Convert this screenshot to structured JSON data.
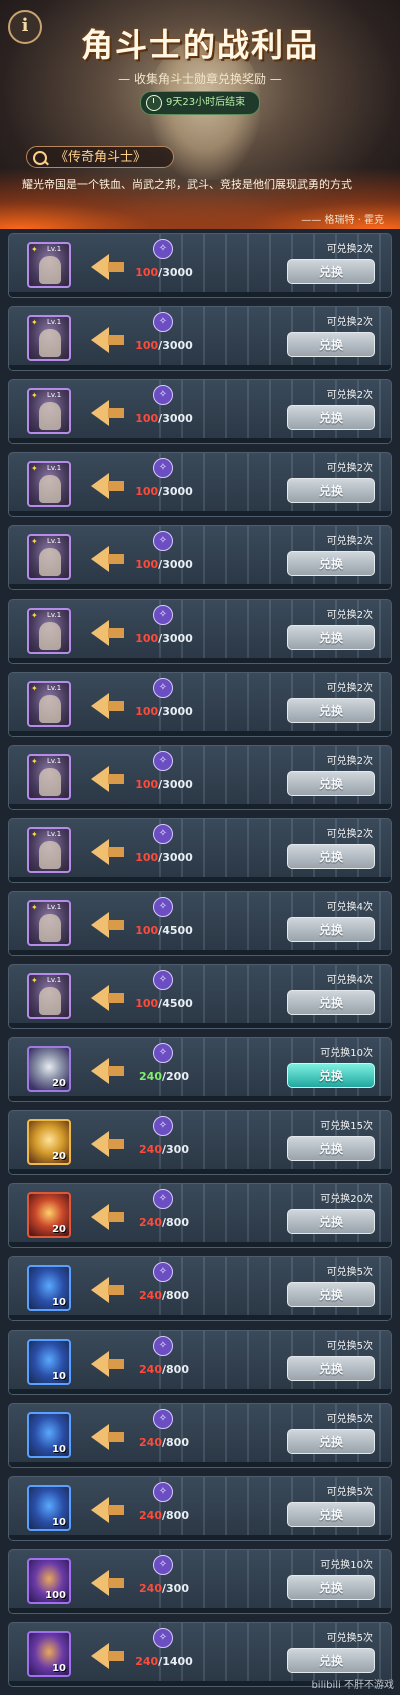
{
  "header": {
    "title": "角斗士的战利品",
    "subtitle": "— 收集角斗士勋章兑换奖励 —",
    "timer": "9天23小时后结束",
    "info_label": "i",
    "lore_tag": "《传奇角斗士》",
    "lore_text": "耀光帝国是一个铁血、尚武之邦，武斗、竞技是他们展现武勇的方式",
    "lore_author": "—— 格瑞特 · 霍克"
  },
  "rows": [
    {
      "item_type": "hero",
      "lv": "Lv.1",
      "qty": "",
      "have": "100",
      "need": "3000",
      "remain": "可兑换2次",
      "button": "兑换",
      "active": false
    },
    {
      "item_type": "hero",
      "lv": "Lv.1",
      "qty": "",
      "have": "100",
      "need": "3000",
      "remain": "可兑换2次",
      "button": "兑换",
      "active": false
    },
    {
      "item_type": "hero",
      "lv": "Lv.1",
      "qty": "",
      "have": "100",
      "need": "3000",
      "remain": "可兑换2次",
      "button": "兑换",
      "active": false
    },
    {
      "item_type": "hero",
      "lv": "Lv.1",
      "qty": "",
      "have": "100",
      "need": "3000",
      "remain": "可兑换2次",
      "button": "兑换",
      "active": false
    },
    {
      "item_type": "hero",
      "lv": "Lv.1",
      "qty": "",
      "have": "100",
      "need": "3000",
      "remain": "可兑换2次",
      "button": "兑换",
      "active": false
    },
    {
      "item_type": "hero",
      "lv": "Lv.1",
      "qty": "",
      "have": "100",
      "need": "3000",
      "remain": "可兑换2次",
      "button": "兑换",
      "active": false
    },
    {
      "item_type": "hero",
      "lv": "Lv.1",
      "qty": "",
      "have": "100",
      "need": "3000",
      "remain": "可兑换2次",
      "button": "兑换",
      "active": false
    },
    {
      "item_type": "hero",
      "lv": "Lv.1",
      "qty": "",
      "have": "100",
      "need": "3000",
      "remain": "可兑换2次",
      "button": "兑换",
      "active": false
    },
    {
      "item_type": "hero",
      "lv": "Lv.1",
      "qty": "",
      "have": "100",
      "need": "3000",
      "remain": "可兑换2次",
      "button": "兑换",
      "active": false
    },
    {
      "item_type": "hero",
      "lv": "Lv.1",
      "qty": "",
      "have": "100",
      "need": "4500",
      "remain": "可兑换4次",
      "button": "兑换",
      "active": false
    },
    {
      "item_type": "hero",
      "lv": "Lv.1",
      "qty": "",
      "have": "100",
      "need": "4500",
      "remain": "可兑换4次",
      "button": "兑换",
      "active": false
    },
    {
      "item_type": "coin-silver",
      "lv": "",
      "qty": "20",
      "have": "240",
      "need": "200",
      "remain": "可兑换10次",
      "button": "兑换",
      "active": true
    },
    {
      "item_type": "coin-gold",
      "lv": "",
      "qty": "20",
      "have": "240",
      "need": "300",
      "remain": "可兑换15次",
      "button": "兑换",
      "active": false
    },
    {
      "item_type": "coin-red",
      "lv": "",
      "qty": "20",
      "have": "240",
      "need": "800",
      "remain": "可兑换20次",
      "button": "兑换",
      "active": false
    },
    {
      "item_type": "card-blue",
      "lv": "",
      "qty": "10",
      "have": "240",
      "need": "800",
      "remain": "可兑换5次",
      "button": "兑换",
      "active": false
    },
    {
      "item_type": "card-blue",
      "lv": "",
      "qty": "10",
      "have": "240",
      "need": "800",
      "remain": "可兑换5次",
      "button": "兑换",
      "active": false
    },
    {
      "item_type": "card-blue",
      "lv": "",
      "qty": "10",
      "have": "240",
      "need": "800",
      "remain": "可兑换5次",
      "button": "兑换",
      "active": false
    },
    {
      "item_type": "card-blue",
      "lv": "",
      "qty": "10",
      "have": "240",
      "need": "800",
      "remain": "可兑换5次",
      "button": "兑换",
      "active": false
    },
    {
      "item_type": "scroll-purple",
      "lv": "",
      "qty": "100",
      "have": "240",
      "need": "300",
      "remain": "可兑换10次",
      "button": "兑换",
      "active": false
    },
    {
      "item_type": "scroll-purple",
      "lv": "",
      "qty": "10",
      "have": "240",
      "need": "1400",
      "remain": "可兑换5次",
      "button": "兑换",
      "active": false
    }
  ],
  "watermark": "bilibili 不肝不游戏"
}
